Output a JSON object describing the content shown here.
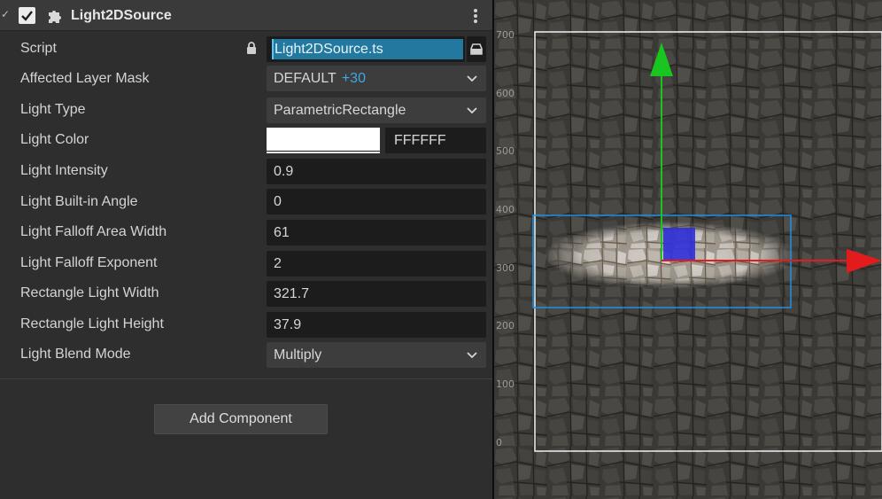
{
  "component": {
    "title": "Light2DSource",
    "enabled": true
  },
  "properties": {
    "script": {
      "label": "Script",
      "value": "Light2DSource.ts"
    },
    "layer_mask": {
      "label": "Affected Layer Mask",
      "value": "DEFAULT",
      "extra": "+30"
    },
    "light_type": {
      "label": "Light Type",
      "value": "ParametricRectangle"
    },
    "light_color": {
      "label": "Light Color",
      "hex": "FFFFFF",
      "swatch": "#ffffff"
    },
    "light_intensity": {
      "label": "Light Intensity",
      "value": "0.9"
    },
    "built_in_angle": {
      "label": "Light Built-in Angle",
      "value": "0"
    },
    "falloff_area_width": {
      "label": "Light Falloff Area Width",
      "value": "61"
    },
    "falloff_exponent": {
      "label": "Light Falloff Exponent",
      "value": "2"
    },
    "rect_width": {
      "label": "Rectangle Light Width",
      "value": "321.7"
    },
    "rect_height": {
      "label": "Rectangle Light Height",
      "value": "37.9"
    },
    "blend_mode": {
      "label": "Light Blend Mode",
      "value": "Multiply"
    }
  },
  "add_component_label": "Add Component",
  "scene": {
    "ruler_labels": [
      "700",
      "600",
      "500",
      "400",
      "300",
      "200",
      "100",
      "0"
    ],
    "gizmo_colors": {
      "y_axis": "#19c61f",
      "x_axis": "#e21c1c",
      "center": "#2e2ed8",
      "selection": "#1e90e8",
      "frame": "#ffffff"
    }
  },
  "colors": {
    "accent": "#3fa7ea",
    "script_asset_bg": "#22789e"
  }
}
